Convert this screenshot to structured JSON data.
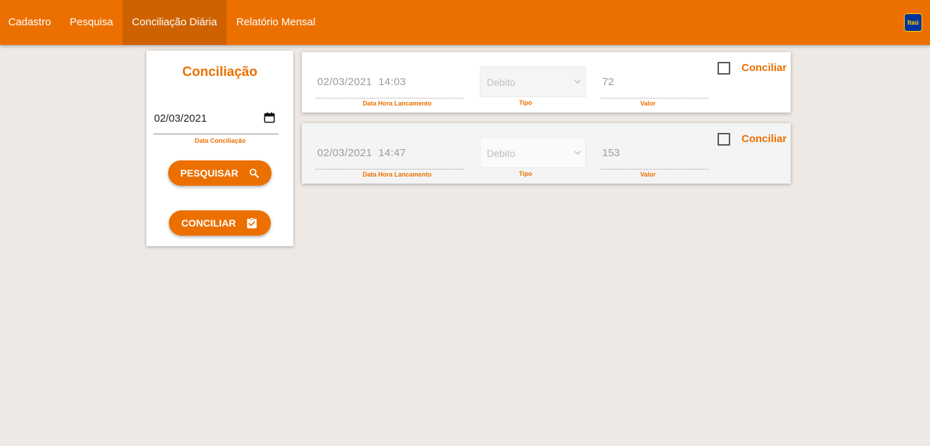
{
  "nav": {
    "items": [
      {
        "label": "Cadastro"
      },
      {
        "label": "Pesquisa"
      },
      {
        "label": "Conciliação Diária"
      },
      {
        "label": "Relatório Mensal"
      }
    ],
    "active_index": 2,
    "logo_text": "Itaú"
  },
  "sidebar": {
    "title": "Conciliação",
    "date_value": "02/03/2021",
    "date_label": "Data Conciliação",
    "search_button": "PESQUISAR",
    "conciliar_button": "CONCILIAR",
    "search_icon": "search-icon",
    "conciliar_icon": "clipboard-check-icon"
  },
  "entries": [
    {
      "datetime": "02/03/2021  14:03",
      "datetime_label": "Data Hora Lancamento",
      "tipo": "Debito",
      "tipo_label": "Tipo",
      "valor": "72",
      "valor_label": "Valor",
      "checked": false,
      "action_label": "Conciliar"
    },
    {
      "datetime": "02/03/2021  14:47",
      "datetime_label": "Data Hora Lancamento",
      "tipo": "Debito",
      "tipo_label": "Tipo",
      "valor": "153",
      "valor_label": "Valor",
      "checked": false,
      "action_label": "Conciliar"
    }
  ],
  "colors": {
    "accent": "#ec7000",
    "accent_dark": "#cf6200",
    "background": "#eee9e5",
    "logo_blue": "#003399",
    "logo_yellow": "#ffd100"
  }
}
